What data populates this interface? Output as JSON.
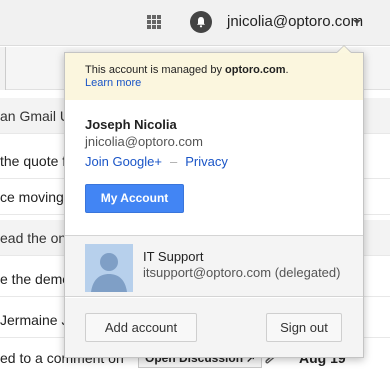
{
  "header": {
    "account_email": "jnicolia@optoro.com",
    "icons": [
      "apps-grid-icon",
      "notifications-bell-icon",
      "dropdown-caret-icon"
    ]
  },
  "mail_list": {
    "rows": [
      {
        "snippet": "an Gmail UI",
        "read": true
      },
      {
        "snippet": "the quote fo",
        "read": false
      },
      {
        "snippet": "ce moving fo",
        "read": false
      },
      {
        "snippet": "ead the onli",
        "read": true
      },
      {
        "snippet": "e the demo",
        "read": false
      },
      {
        "snippet": "Jermaine Jo",
        "read": false
      },
      {
        "snippet": "ed to a comment on",
        "read": false,
        "badge": "Open Discussion",
        "date": "Aug 19"
      }
    ]
  },
  "account_popup": {
    "managed_notice_prefix": "This account is managed by ",
    "managed_domain": "optoro.com",
    "managed_notice_suffix": ".",
    "learn_more": "Learn more",
    "user_name": "Joseph Nicolia",
    "user_email": "jnicolia@optoro.com",
    "join_google_plus": "Join Google+",
    "separator": "–",
    "privacy": "Privacy",
    "my_account_button": "My Account",
    "delegated_account": {
      "name": "IT Support",
      "email": "itsupport@optoro.com (delegated)"
    },
    "add_account_button": "Add account",
    "sign_out_button": "Sign out"
  },
  "colors": {
    "primary_button": "#4285f4",
    "link": "#1a55c7",
    "notice_bg": "#fbf6de",
    "avatar_bg": "#b7d0ec"
  }
}
